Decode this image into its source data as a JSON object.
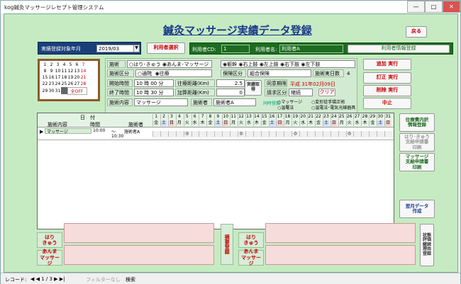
{
  "window": {
    "title": "kog鍼灸マッサージレセプト管理システム"
  },
  "header": {
    "title": "鍼灸マッサージ実績データ登録",
    "back_label": "戻る"
  },
  "toprow": {
    "target_label": "実績登録対象年月",
    "target_value": "2019/03",
    "user_select_label": "利用者選択",
    "user_cd_label": "利用者CD:",
    "user_cd_value": "1",
    "user_name_label": "利用者名:",
    "user_name_value": "利用者A",
    "user_info_register_label": "利用者情報登録"
  },
  "calendar": {
    "rows": [
      [
        "1",
        "2",
        "3",
        "4",
        "5",
        "6",
        "7"
      ],
      [
        "8",
        "9",
        "10",
        "11",
        "12",
        "13",
        "14"
      ],
      [
        "15",
        "16",
        "17",
        "18",
        "19",
        "20",
        "21"
      ],
      [
        "22",
        "23",
        "24",
        "25",
        "26",
        "27",
        "28"
      ],
      [
        "29",
        "30",
        "31",
        "",
        ""
      ]
    ],
    "all_off": "全OFF"
  },
  "form": {
    "treatment_label": "施術",
    "opt_hari": "はり･きゅう",
    "opt_anma": "あんま･マッサージ",
    "cat_label": "施術区分",
    "opt_tsuin": "通院",
    "opt_orai": "往療",
    "parts": [
      "躯幹",
      "右上肢",
      "左上肢",
      "右下肢",
      "左下肢"
    ],
    "start_label": "開始時間",
    "start_value": "10 時 00 分",
    "end_label": "終了時間",
    "end_value": "10 時 30 分",
    "dist_label": "往療距離(Km)",
    "dist_value": "2.5",
    "add_dist_label": "加算距離(Km)",
    "add_dist_value": "0",
    "content_label": "施術内容",
    "content_value": "マッサージ",
    "practitioner_label": "施術者",
    "practitioner_value": "施術者A",
    "insurance_label": "保険区分",
    "insurance_value": "組合保険",
    "days_label": "施術実日数",
    "days_value": "4",
    "consent_label": "同意期限",
    "consent_value": "平成 31年02月09日",
    "billing_label": "請求区分",
    "billing_value": "継続",
    "clear_label": "クリア",
    "repeat_label": "実績取得",
    "sim_label": "同時登録",
    "sim_opts": [
      "マッサージ",
      "変形徒手矯正術",
      "温罨法",
      "温電法･電気光線器具"
    ]
  },
  "actions": {
    "add": "追加 実行",
    "edit": "訂正 実行",
    "del": "削除 実行",
    "stop": "中止"
  },
  "grid": {
    "h_date": "日　付",
    "h_content": "施術内容",
    "h_time": "時間",
    "h_prac": "施術者",
    "days": [
      "1",
      "2",
      "3",
      "4",
      "5",
      "6",
      "7",
      "8",
      "9",
      "10",
      "11",
      "12",
      "13",
      "14",
      "15",
      "16",
      "17",
      "18",
      "19",
      "20",
      "21",
      "22",
      "23",
      "24",
      "25",
      "26",
      "27",
      "28",
      "29",
      "30",
      "31"
    ],
    "weekdays": [
      "金",
      "土",
      "日",
      "月",
      "火",
      "水",
      "木",
      "金",
      "土",
      "日",
      "月",
      "火",
      "水",
      "木",
      "金",
      "土",
      "日",
      "月",
      "火",
      "水",
      "木",
      "金",
      "土",
      "日",
      "月",
      "火",
      "水",
      "木",
      "金",
      "土",
      "日"
    ],
    "row": {
      "content": "マッサージ",
      "time_from": "10:00",
      "time_sep": "〜",
      "time_to": "10:30",
      "prac": "施術者A",
      "mark": "◎"
    }
  },
  "right": {
    "b1": "往療費内訳\n情報登録",
    "b2": "はり･きゅう\n支給申請書\n印刷",
    "b3": "マッサージ\n支給申請書\n印刷",
    "b4": "翌月データ\n作成"
  },
  "bottom": {
    "hari": "はり\nきゅう",
    "anma": "あんま\nマッサージ",
    "summary": "摘要登録",
    "hari2": "はり\nきゅう",
    "anma2": "あんま\nマッサージ",
    "side": "状態\n評価\n継続\n理由\n登録"
  },
  "statusbar": {
    "record": "レコード:",
    "nav": "◀ ◀ 1 / 3 ▶ ▶|",
    "filter": "フィルターなし",
    "search": "検索"
  }
}
